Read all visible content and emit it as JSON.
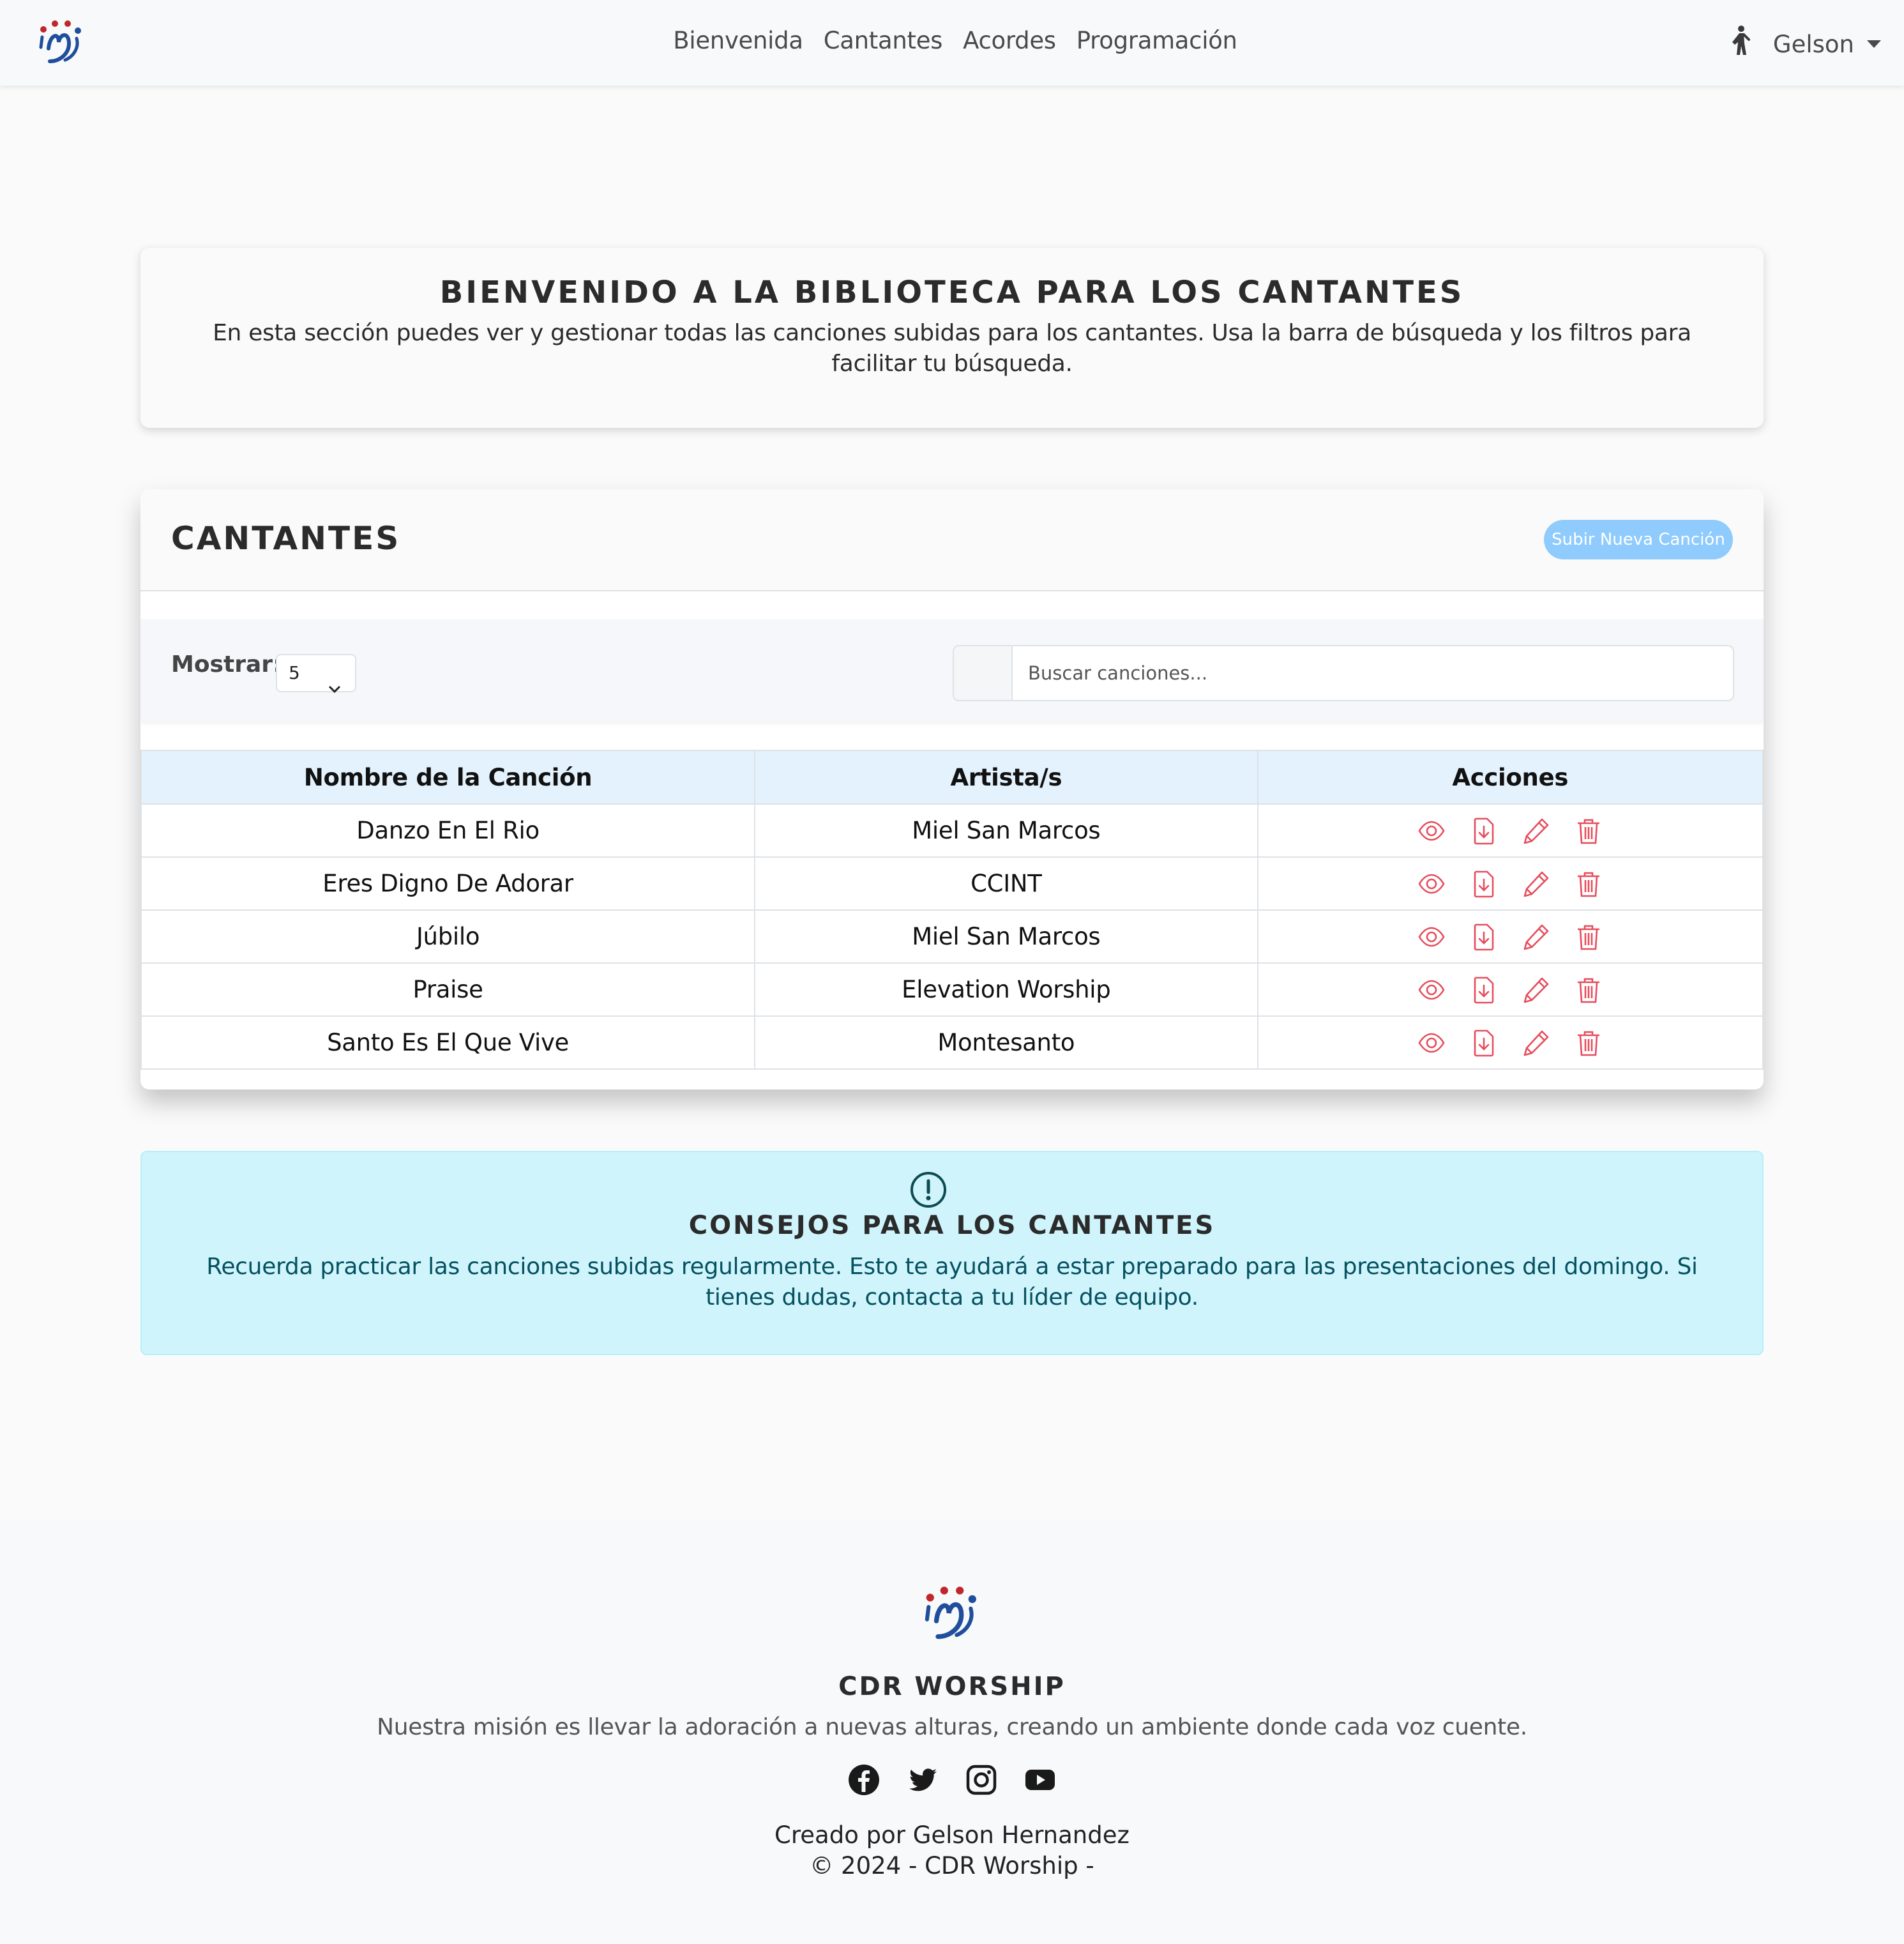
{
  "nav": {
    "links": [
      "Bienvenida",
      "Cantantes",
      "Acordes",
      "Programación"
    ],
    "user": "Gelson"
  },
  "welcome": {
    "title": "BIENVENIDO A LA BIBLIOTECA PARA LOS CANTANTES",
    "text": "En esta sección puedes ver y gestionar todas las canciones subidas para los cantantes. Usa la barra de búsqueda y los filtros para facilitar tu búsqueda."
  },
  "songs": {
    "title": "CANTANTES",
    "upload_label": "Subir Nueva Canción",
    "show_label": "Mostrar:",
    "show_value": "5",
    "search_placeholder": "Buscar canciones...",
    "columns": [
      "Nombre de la Canción",
      "Artista/s",
      "Acciones"
    ],
    "rows": [
      {
        "name": "Danzo En El Rio",
        "artist": "Miel San Marcos"
      },
      {
        "name": "Eres Digno De Adorar",
        "artist": "CCINT"
      },
      {
        "name": "Júbilo",
        "artist": "Miel San Marcos"
      },
      {
        "name": "Praise",
        "artist": "Elevation Worship"
      },
      {
        "name": "Santo Es El Que Vive",
        "artist": "Montesanto"
      }
    ],
    "action_icons": [
      "eye-icon",
      "file-download-icon",
      "pencil-icon",
      "trash-icon"
    ]
  },
  "tips": {
    "title": "CONSEJOS PARA LOS CANTANTES",
    "text": "Recuerda practicar las canciones subidas regularmente. Esto te ayudará a estar preparado para las presentaciones del domingo. Si tienes dudas, contacta a tu líder de equipo."
  },
  "footer": {
    "title": "CDR WORSHIP",
    "mission": "Nuestra misión es llevar la adoración a nuevas alturas, creando un ambiente donde cada voz cuente.",
    "social_icons": [
      "facebook-icon",
      "twitter-icon",
      "instagram-icon",
      "youtube-icon"
    ],
    "credit": "Creado por Gelson Hernandez",
    "copyright": "© 2024 - CDR Worship -"
  },
  "colors": {
    "accent_icon": "#e74c5c",
    "upload_button": "#8fcbfd",
    "table_header": "#e3f2fd",
    "tips_bg": "#cff4fc",
    "tips_text": "#055160"
  }
}
